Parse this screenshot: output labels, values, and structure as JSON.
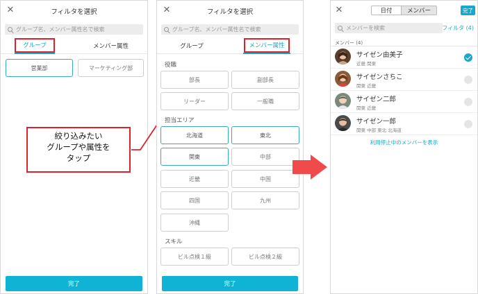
{
  "panel1": {
    "title": "フィルタを選択",
    "search_placeholder": "グループ名、メンバー属性名で検索",
    "tabs": [
      "グループ",
      "メンバー属性"
    ],
    "groups": [
      {
        "label": "営業部",
        "selected": true
      },
      {
        "label": "マーケティング部",
        "selected": false
      }
    ],
    "done_label": "完了"
  },
  "callout": {
    "lines": [
      "絞り込みたい",
      "グループや属性を",
      "タップ"
    ]
  },
  "panel2": {
    "title": "フィルタを選択",
    "search_placeholder": "グループ名、メンバー属性名で検索",
    "tabs": [
      "グループ",
      "メンバー属性"
    ],
    "sections": [
      {
        "title": "役職",
        "chips": [
          {
            "label": "部長",
            "selected": false
          },
          {
            "label": "副部長",
            "selected": false
          },
          {
            "label": "リーダー",
            "selected": false
          },
          {
            "label": "一般職",
            "selected": false
          }
        ]
      },
      {
        "title": "担当エリア",
        "chips": [
          {
            "label": "北海道",
            "selected": true
          },
          {
            "label": "東北",
            "selected": true
          },
          {
            "label": "関東",
            "selected": true
          },
          {
            "label": "中部",
            "selected": false
          },
          {
            "label": "近畿",
            "selected": false
          },
          {
            "label": "中国",
            "selected": false
          },
          {
            "label": "四国",
            "selected": false
          },
          {
            "label": "九州",
            "selected": false
          },
          {
            "label": "沖縄",
            "selected": false
          }
        ]
      },
      {
        "title": "スキル",
        "chips": [
          {
            "label": "ビル点検１級",
            "selected": false
          },
          {
            "label": "ビル点検２級",
            "selected": false
          }
        ]
      }
    ],
    "done_label": "完了"
  },
  "panel3": {
    "segments": [
      "日付",
      "メンバー"
    ],
    "done_label": "完了",
    "search_placeholder": "メンバーを検索",
    "filter_label": "フィルタ (4)",
    "members_header": "メンバー (4)",
    "members": [
      {
        "name": "サイゼン由美子",
        "areas": "近畿 関東",
        "checked": true
      },
      {
        "name": "サイゼンさちこ",
        "areas": "関東 近畿",
        "checked": false
      },
      {
        "name": "サイゼン二郎",
        "areas": "関東 近畿",
        "checked": false
      },
      {
        "name": "サイゼン一郎",
        "areas": "関東 中部 東北 北海道",
        "checked": false
      }
    ],
    "show_suspended_link": "利用停止中のメンバーを表示"
  },
  "colors": {
    "accent": "#1aa7c9",
    "highlight_red": "#e0202a",
    "arrow_red": "#f04a4a"
  }
}
